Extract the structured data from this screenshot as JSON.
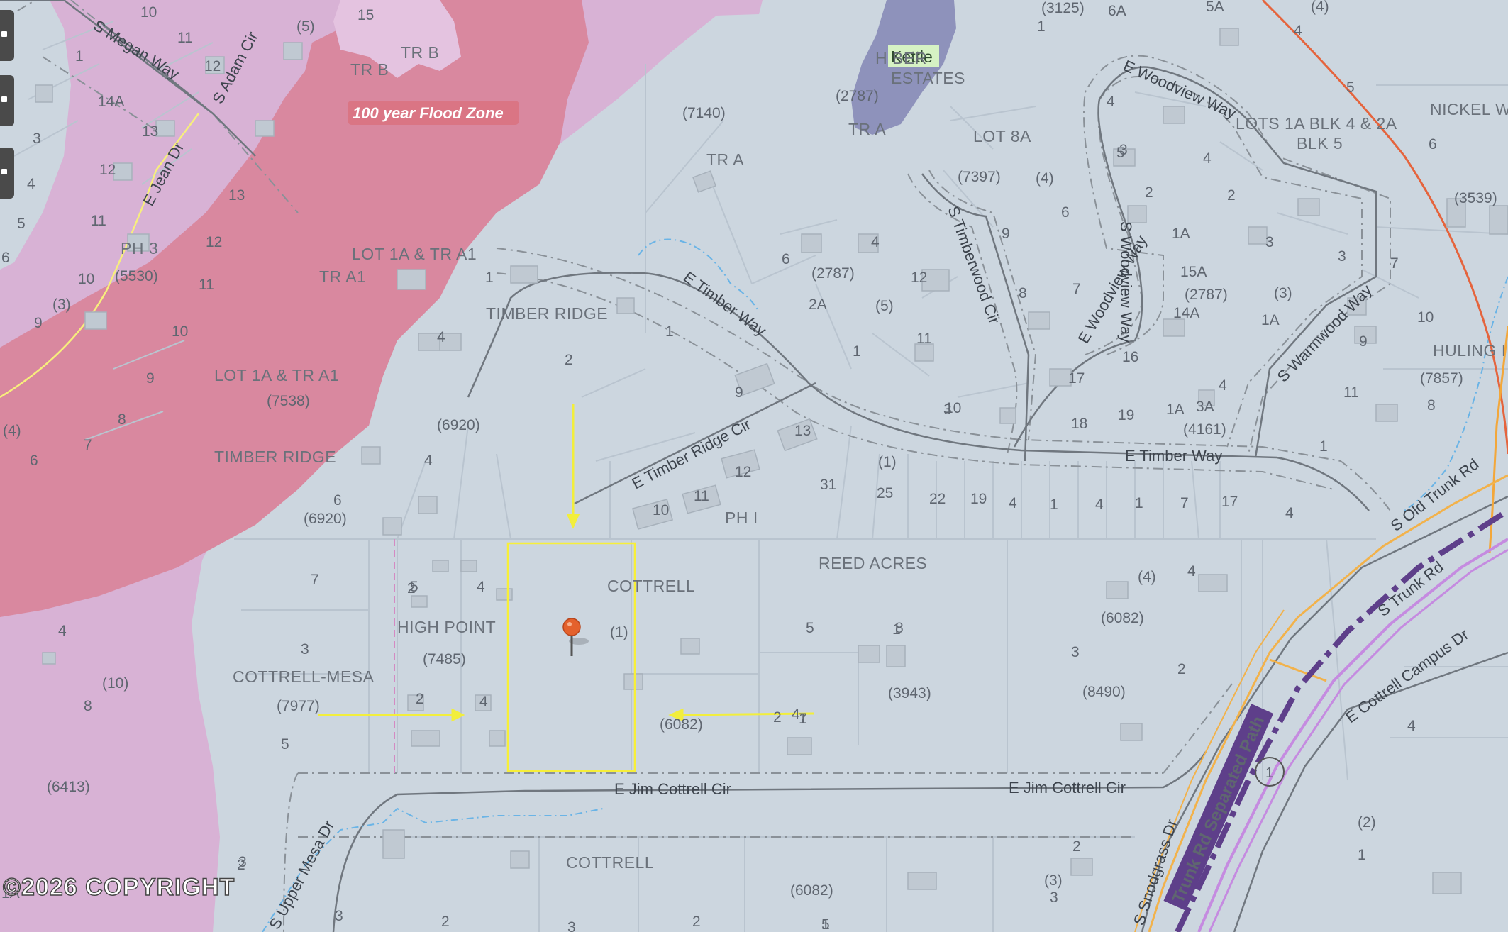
{
  "copyright": "©2026 COPYRIGHT",
  "flood_label": "100 year Flood Zone",
  "kettle_label": "Kettle",
  "pin": {
    "name": "map-pin"
  },
  "subdivisions": {
    "timber_ridge_1": "TIMBER RIDGE",
    "timber_ridge_2": "TIMBER RIDGE",
    "lot1a_1": "LOT 1A & TR A1",
    "lot1a_2": "LOT 1A & TR A1",
    "tr_a1": "TR A1",
    "tr_b": "TR B",
    "tr_b2": "TR B",
    "tr_a_1": "TR A",
    "tr_a_2": "TR A",
    "ph3": "PH 3",
    "ph1": "PH I",
    "hb_estates_1": "H   BER",
    "hb_estates_2": "ESTATES",
    "lot8a": "LOT 8A",
    "lots1a": "LOTS 1A BLK 4 & 2A",
    "blk5": "BLK 5",
    "nickel": "NICKEL W",
    "huling": "HULING I",
    "reed_acres": "REED ACRES",
    "cottrell_1": "COTTRELL",
    "cottrell_2": "COTTRELL",
    "high_point": "HIGH POINT",
    "cottrell_mesa": "COTTRELL-MESA"
  },
  "plats": {
    "p3125": "(3125)",
    "p2787a": "(2787)",
    "p7140": "(7140)",
    "p7397": "(7397)",
    "p2787b": "(2787)",
    "p2787c": "(2787)",
    "p3539": "(3539)",
    "p7857": "(7857)",
    "p4161": "(4161)",
    "p5530": "(5530)",
    "p7538": "(7538)",
    "p6920a": "(6920)",
    "p6920b": "(6920)",
    "p7485": "(7485)",
    "p7977": "(7977)",
    "p6413": "(6413)",
    "p6082a": "(6082)",
    "p6082b": "(6082)",
    "p6082c": "(6082)",
    "p3943": "(3943)",
    "p8490": "(8490)"
  },
  "blocks": {
    "b5top": "(5)",
    "b4top": "(4)",
    "b4b": "(4)",
    "b5mid": "(5)",
    "b3right": "(3)",
    "b3left": "(3)",
    "b4left": "(4)",
    "b1mid": "(1)",
    "b1cot": "(1)",
    "b4reed": "(4)",
    "b10": "(10)",
    "b3bot": "(3)",
    "b2right": "(2)"
  },
  "roads": {
    "megan": "S Megan Way",
    "adam": "S Adam Cir",
    "jean": "E Jean Dr",
    "woodview_top": "E Woodview Way",
    "woodview_mid": "E Woodview Way",
    "woodview_s": "S Woodview Way",
    "timberwood": "S Timberwood Cir",
    "timber_way_1": "E Timber Way",
    "timber_way_2": "E Timber Way",
    "timber_ridge_cir": "E Timber Ridge Cir",
    "warmwood": "S Warmwood Way",
    "old_trunk": "S Old Trunk Rd",
    "trunk": "S Trunk Rd",
    "cottrell_campus": "E Cottrell Campus Dr",
    "jim_cottrell_1": "E Jim Cottrell Cir",
    "jim_cottrell_2": "E Jim Cottrell Cir",
    "upper_mesa": "S Upper Mesa Dr",
    "snodgrass": "S Snodgrass Dr",
    "trunk_path": "Trunk Rd Separated Path",
    "route_num": "1"
  },
  "lots": [
    "10",
    "15",
    "11",
    "12",
    "1",
    "14A",
    "13",
    "3",
    "12",
    "4",
    "5",
    "6",
    "13",
    "11",
    "12",
    "10",
    "11",
    "9",
    "10",
    "9",
    "8",
    "7",
    "6",
    "4",
    "8",
    "7",
    "6",
    "5",
    "4",
    "3",
    "2",
    "1A",
    "2",
    "4",
    "5",
    "3",
    "3",
    "2",
    "3",
    "2",
    "5",
    "1",
    "4",
    "2",
    "1",
    "4",
    "2",
    "8",
    "7",
    "5",
    "4",
    "6",
    "2A",
    "1",
    "12",
    "11",
    "10",
    "9",
    "13",
    "12",
    "11",
    "10",
    "9",
    "8",
    "7",
    "6",
    "5",
    "4",
    "3",
    "2",
    "1A",
    "15A",
    "14A",
    "16",
    "17",
    "18",
    "19",
    "1A",
    "3A",
    "2",
    "4",
    "3",
    "3",
    "1A",
    "4",
    "1",
    "11",
    "10",
    "9",
    "8",
    "7",
    "6",
    "5",
    "4",
    "3",
    "2",
    "1",
    "31",
    "25",
    "22",
    "19",
    "4",
    "1",
    "4",
    "1",
    "7",
    "17",
    "4",
    "3",
    "2",
    "1",
    "1",
    "4",
    "3",
    "2",
    "1",
    "4",
    "1",
    "6A",
    "5A",
    "4",
    "3"
  ],
  "colors": {
    "base": "#ccd6df",
    "flood_light": "#d7b1d4",
    "flood_dark": "#d887a6",
    "lake": "#8f92ba",
    "highlight": "#f7ef39",
    "arrow": "#f2ee3c",
    "path_purple": "#5e3f8a",
    "trunk_orange": "#f2b24b",
    "trunk_violet": "#c58be0",
    "red_line": "#e5643d"
  }
}
